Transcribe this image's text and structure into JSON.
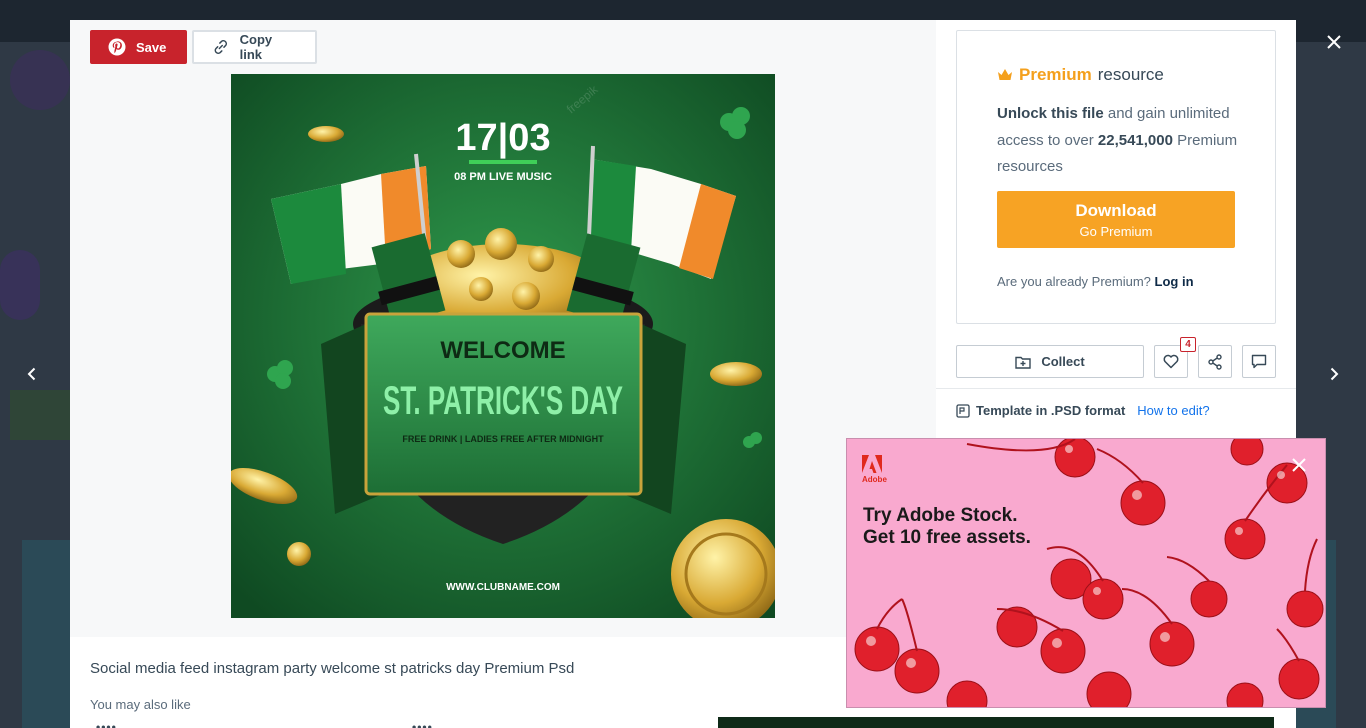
{
  "toolbar": {
    "save_label": "Save",
    "copy_label": "Copy link"
  },
  "preview": {
    "date": "17|03",
    "time_line": "08 PM LIVE MUSIC",
    "welcome": "WELCOME",
    "event_line1": "ST. PATRICK'S DAY",
    "tagline": "FREE DRINK | LADIES FREE AFTER MIDNIGHT",
    "url": "WWW.CLUBNAME.COM",
    "watermark": "freepik"
  },
  "caption": "Social media feed instagram party welcome st patricks day Premium Psd",
  "also_like": "You may also like",
  "premium": {
    "highlight": "Premium",
    "rest": "resource",
    "unlock_bold": "Unlock this file",
    "unlock_rest": "and gain unlimited access to over",
    "count": "22,541,000",
    "count_rest": "Premium resources",
    "download_label": "Download",
    "download_sub": "Go Premium",
    "already": "Are you already Premium?",
    "login": "Log in"
  },
  "actions": {
    "collect_label": "Collect",
    "like_count": "4"
  },
  "format": {
    "text": "Template in .PSD format",
    "how_to_edit": "How to edit?"
  },
  "ad": {
    "brand": "Adobe",
    "line1": "Try Adobe Stock.",
    "line2": "Get 10 free assets."
  },
  "colors": {
    "save_red": "#c8232c",
    "premium_orange": "#f7a324",
    "link_blue": "#1273eb",
    "ad_pink": "#f9a9cf"
  },
  "icons": [
    "pinterest-icon",
    "link-icon",
    "crown-icon",
    "collect-icon",
    "heart-icon",
    "share-icon",
    "comment-icon",
    "file-format-icon",
    "close-icon",
    "chevron-left-icon",
    "chevron-right-icon",
    "adobe-logo-icon"
  ]
}
